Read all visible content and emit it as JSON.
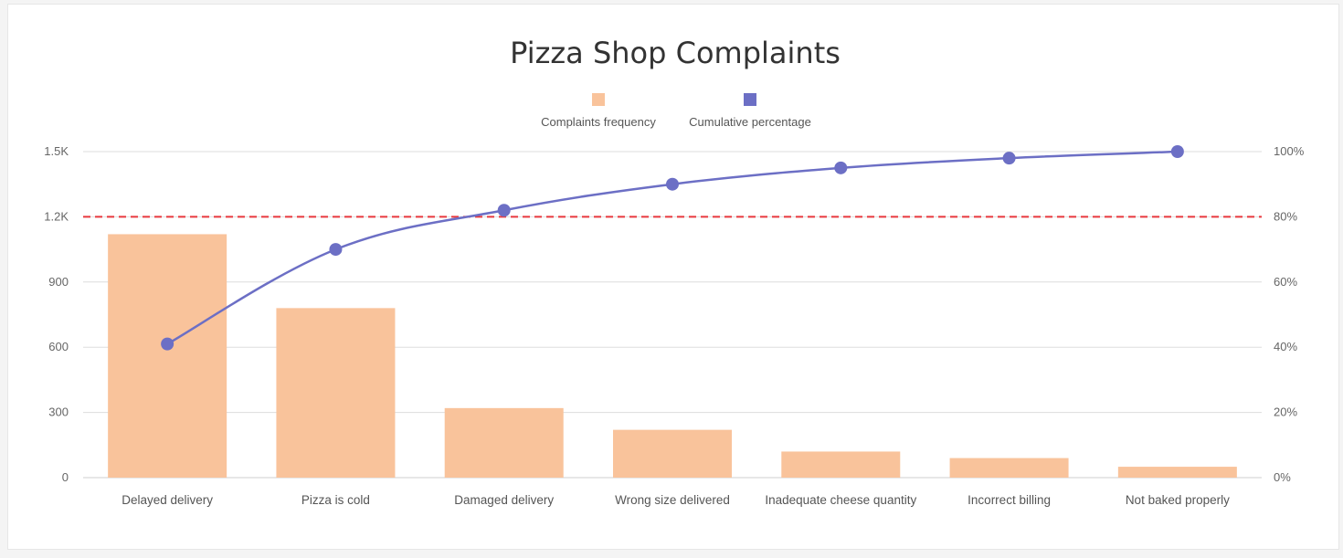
{
  "chart_data": {
    "type": "bar",
    "title": "Pizza Shop Complaints",
    "categories": [
      "Delayed delivery",
      "Pizza is cold",
      "Damaged delivery",
      "Wrong size delivered",
      "Inadequate cheese quantity",
      "Incorrect billing",
      "Not baked properly"
    ],
    "series": [
      {
        "name": "Complaints frequency",
        "type": "bar",
        "axis": "left",
        "color": "#f9c39b",
        "values": [
          1120,
          780,
          320,
          220,
          120,
          90,
          50
        ]
      },
      {
        "name": "Cumulative percentage",
        "type": "line",
        "axis": "right",
        "color": "#6c6fc5",
        "values": [
          41,
          70,
          82,
          90,
          95,
          98,
          100
        ]
      }
    ],
    "left_axis": {
      "ylim": [
        0,
        1500
      ],
      "ticks": [
        0,
        300,
        600,
        900,
        1200,
        1500
      ],
      "tick_labels": [
        "0",
        "300",
        "600",
        "900",
        "1.2K",
        "1.5K"
      ]
    },
    "right_axis": {
      "ylim": [
        0,
        100
      ],
      "ticks": [
        0,
        20,
        40,
        60,
        80,
        100
      ],
      "tick_labels": [
        "0%",
        "20%",
        "40%",
        "60%",
        "80%",
        "100%"
      ]
    },
    "threshold": {
      "value": 80,
      "axis": "right",
      "color": "#e8383d",
      "style": "dashed"
    },
    "legend_position": "top-center",
    "grid": true
  }
}
